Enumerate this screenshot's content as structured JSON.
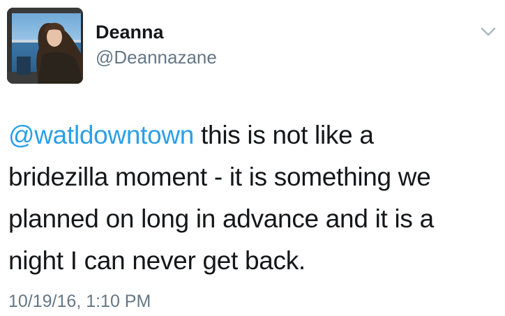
{
  "author": {
    "name": "Deanna",
    "handle": "@Deannazane",
    "avatar_icon": "profile-photo-avatar"
  },
  "menu": {
    "icon": "chevron-down-icon"
  },
  "tweet": {
    "mention": "@watldowntown",
    "line1_rest": " this is not like a",
    "line2": "bridezilla moment - it is something we",
    "line3": "planned on long in advance and it is a",
    "line4": "night I can never get back."
  },
  "timestamp": "10/19/16, 1:10 PM",
  "colors": {
    "mention": "#2b9fe8",
    "secondary_text": "#657786",
    "primary_text": "#14171a"
  }
}
